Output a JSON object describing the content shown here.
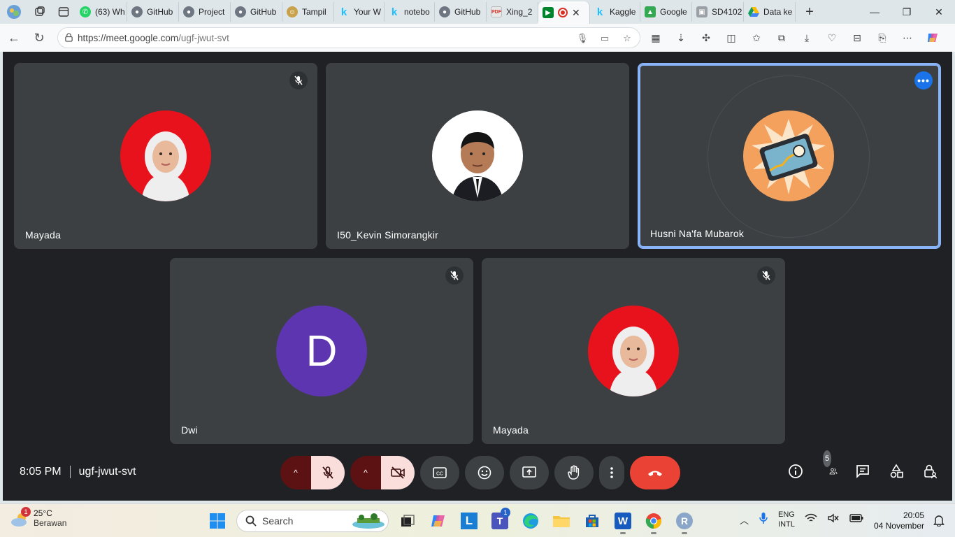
{
  "browser": {
    "tabs": [
      {
        "label": "(63) Wh",
        "icon": "whatsapp-icon",
        "color": "#25d366"
      },
      {
        "label": "GitHub",
        "icon": "github-icon",
        "color": "#333333"
      },
      {
        "label": "Project",
        "icon": "github-icon",
        "color": "#333333"
      },
      {
        "label": "GitHub",
        "icon": "github-icon",
        "color": "#333333"
      },
      {
        "label": "Tampil",
        "icon": "smiley-icon",
        "color": "#c8a24a"
      },
      {
        "label": "Your W",
        "icon": "kaggle-icon",
        "color": "#20beff"
      },
      {
        "label": "notebo",
        "icon": "kaggle-icon",
        "color": "#20beff"
      },
      {
        "label": "GitHub",
        "icon": "github-icon",
        "color": "#333333"
      },
      {
        "label": "Xing_2",
        "icon": "pdf-icon",
        "color": "#d93025"
      },
      {
        "label": "",
        "icon": "meet-icon",
        "color": "#00832d"
      },
      {
        "label": "Kaggle",
        "icon": "kaggle-icon",
        "color": "#20beff"
      },
      {
        "label": "Google",
        "icon": "maps-icon",
        "color": "#34a853"
      },
      {
        "label": "SD4102",
        "icon": "contact-icon",
        "color": "#5f6368"
      },
      {
        "label": "Data ke",
        "icon": "drive-icon",
        "color": "#fbbc04"
      }
    ],
    "url_host": "https://meet.google.com",
    "url_path": "/ugf-jwut-svt"
  },
  "meet": {
    "participants": [
      {
        "name": "Mayada",
        "avatar": "photo",
        "muted": true
      },
      {
        "name": "I50_Kevin Simorangkir",
        "avatar": "photo",
        "muted": false
      },
      {
        "name": "Husni Na'fa Mubarok",
        "avatar": "illustration",
        "muted": false,
        "speaking": true
      },
      {
        "name": "Dwi",
        "avatar": "letter",
        "initial": "D",
        "muted": true,
        "avatar_color": "#5e35b1"
      },
      {
        "name": "Mayada",
        "avatar": "photo",
        "muted": true
      }
    ],
    "time": "8:05 PM",
    "meeting_code": "ugf-jwut-svt",
    "people_count": "5",
    "end_call_color": "#ea4335"
  },
  "taskbar": {
    "weather_badge": "1",
    "temperature": "25°C",
    "condition": "Berawan",
    "search_placeholder": "Search",
    "teams_badge": "1",
    "lang_line1": "ENG",
    "lang_line2": "INTL",
    "clock_time": "20:05",
    "clock_date": "04 November"
  }
}
